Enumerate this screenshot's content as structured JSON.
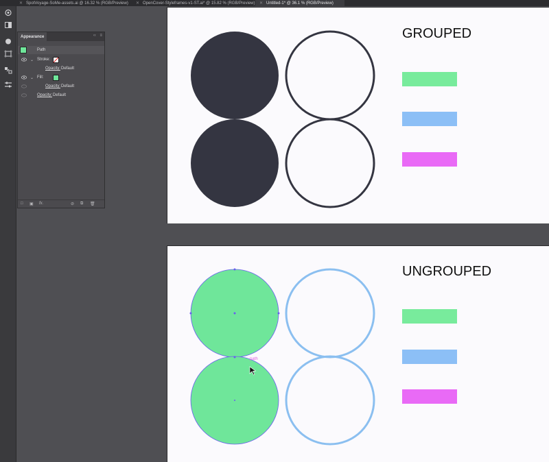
{
  "tabs": [
    {
      "label": "SpotVoyage-SoMe-assets.ai @ 16.32 % (RGB/Preview)",
      "active": false
    },
    {
      "label": "OpenCover-Styleframes-v1-ST.ai* @ 15.82 % (RGB/Preview)",
      "active": false
    },
    {
      "label": "Untitled-1* @ 36.1 % (RGB/Preview)",
      "active": true
    }
  ],
  "toolbar": {
    "tools": [
      "symbol-sprayer-icon",
      "gradient-icon",
      "fill-stroke-icon",
      "artboard-icon",
      "symbol-icon",
      "align-icon"
    ]
  },
  "appearance": {
    "title": "Appearance",
    "collapse_glyph": "‹‹",
    "menu_glyph": "≡",
    "object_label": "Path",
    "stroke_label": "Stroke:",
    "stroke_opacity_label": "Opacity:",
    "stroke_opacity_value": "Default",
    "fill_label": "Fill:",
    "fill_opacity_label": "Opacity:",
    "fill_opacity_value": "Default",
    "opacity_label": "Opacity:",
    "opacity_value": "Default",
    "fill_color": "#6fe69a",
    "footer_fx": "fx."
  },
  "artboard_grouped": {
    "title": "GROUPED",
    "circle_fill": "#343541",
    "outline_color": "#343541"
  },
  "artboard_ungrouped": {
    "title": "UNGROUPED",
    "circle_fill": "#6fe69a",
    "outline_color": "#8bbff0",
    "selection_color": "#6a5cf0",
    "smart_guide_label": "path",
    "smart_guide_color": "#e060e0"
  },
  "legend_colors": [
    "#78eb9c",
    "#8cbff6",
    "#e96af6"
  ]
}
